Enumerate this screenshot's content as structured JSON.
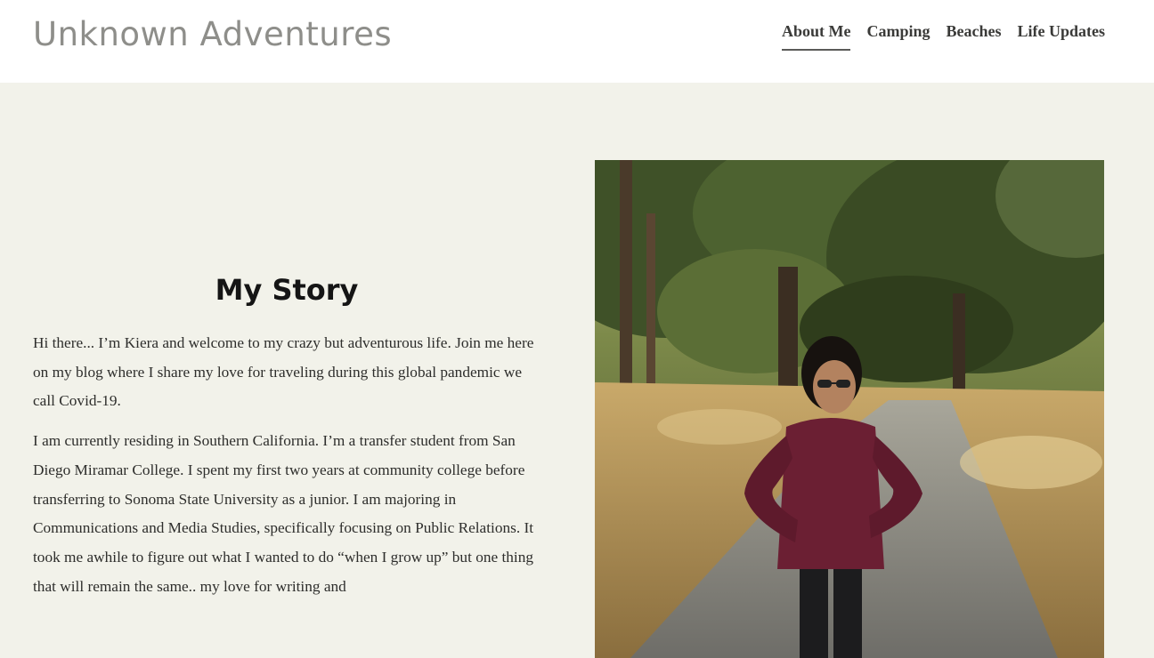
{
  "header": {
    "site_title": "Unknown Adventures",
    "nav": [
      {
        "label": "About Me",
        "active": true
      },
      {
        "label": "Camping",
        "active": false
      },
      {
        "label": "Beaches",
        "active": false
      },
      {
        "label": "Life Updates",
        "active": false
      }
    ]
  },
  "main": {
    "heading": "My Story",
    "paragraphs": [
      "Hi there... I’m Kiera and welcome to my crazy but adventurous life. Join me here on my blog where I share my love for traveling during this global pandemic we call Covid-19.",
      "I am currently residing in Southern California. I’m a transfer student from San Diego Miramar College. I spent my first two years at community college before transferring to Sonoma State University as a junior. I am majoring in Communications and Media Studies, specifically focusing on Public Relations. It took me awhile to figure out what I wanted to do “when I grow up” but one thing that will remain the same.. my love for writing and"
    ]
  },
  "colors": {
    "page_background": "#f2f2ea",
    "header_background": "#ffffff",
    "title_color": "#8e8e8a",
    "nav_text": "#3a3a38"
  }
}
